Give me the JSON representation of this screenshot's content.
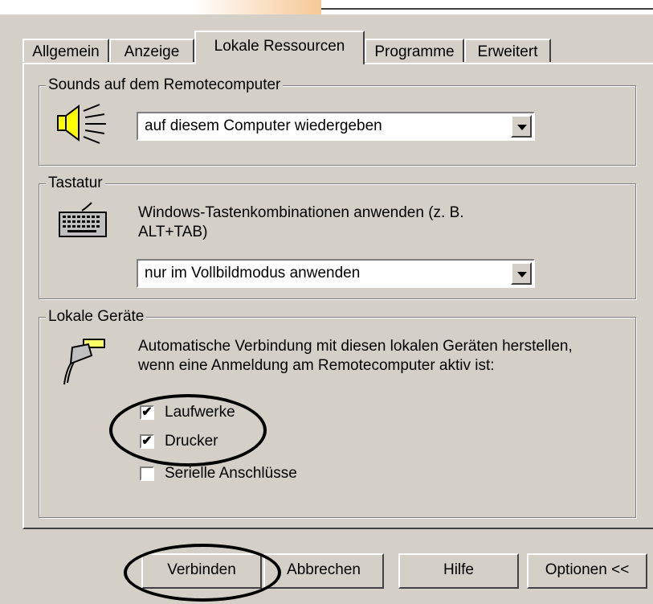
{
  "tabs": [
    {
      "label": "Allgemein"
    },
    {
      "label": "Anzeige"
    },
    {
      "label": "Lokale Ressourcen"
    },
    {
      "label": "Programme"
    },
    {
      "label": "Erweitert"
    }
  ],
  "sound": {
    "legend": "Sounds auf dem Remotecomputer",
    "value": "auf diesem Computer wiedergeben"
  },
  "keyboard": {
    "legend": "Tastatur",
    "desc1": "Windows-Tastenkombinationen anwenden (z. B.",
    "desc2": "ALT+TAB)",
    "value": "nur im Vollbildmodus anwenden"
  },
  "devices": {
    "legend": "Lokale Geräte",
    "desc1": "Automatische Verbindung mit diesen lokalen Geräten herstellen,",
    "desc2": "wenn eine Anmeldung am Remotecomputer aktiv ist:",
    "items": [
      {
        "label": "Laufwerke",
        "checked": true,
        "mark": "✔"
      },
      {
        "label": "Drucker",
        "checked": true,
        "mark": "✔"
      },
      {
        "label": "Serielle Anschlüsse",
        "checked": false,
        "mark": ""
      }
    ]
  },
  "buttons": {
    "connect": "Verbinden",
    "cancel": "Abbrechen",
    "help": "Hilfe",
    "options": "Optionen <<"
  }
}
